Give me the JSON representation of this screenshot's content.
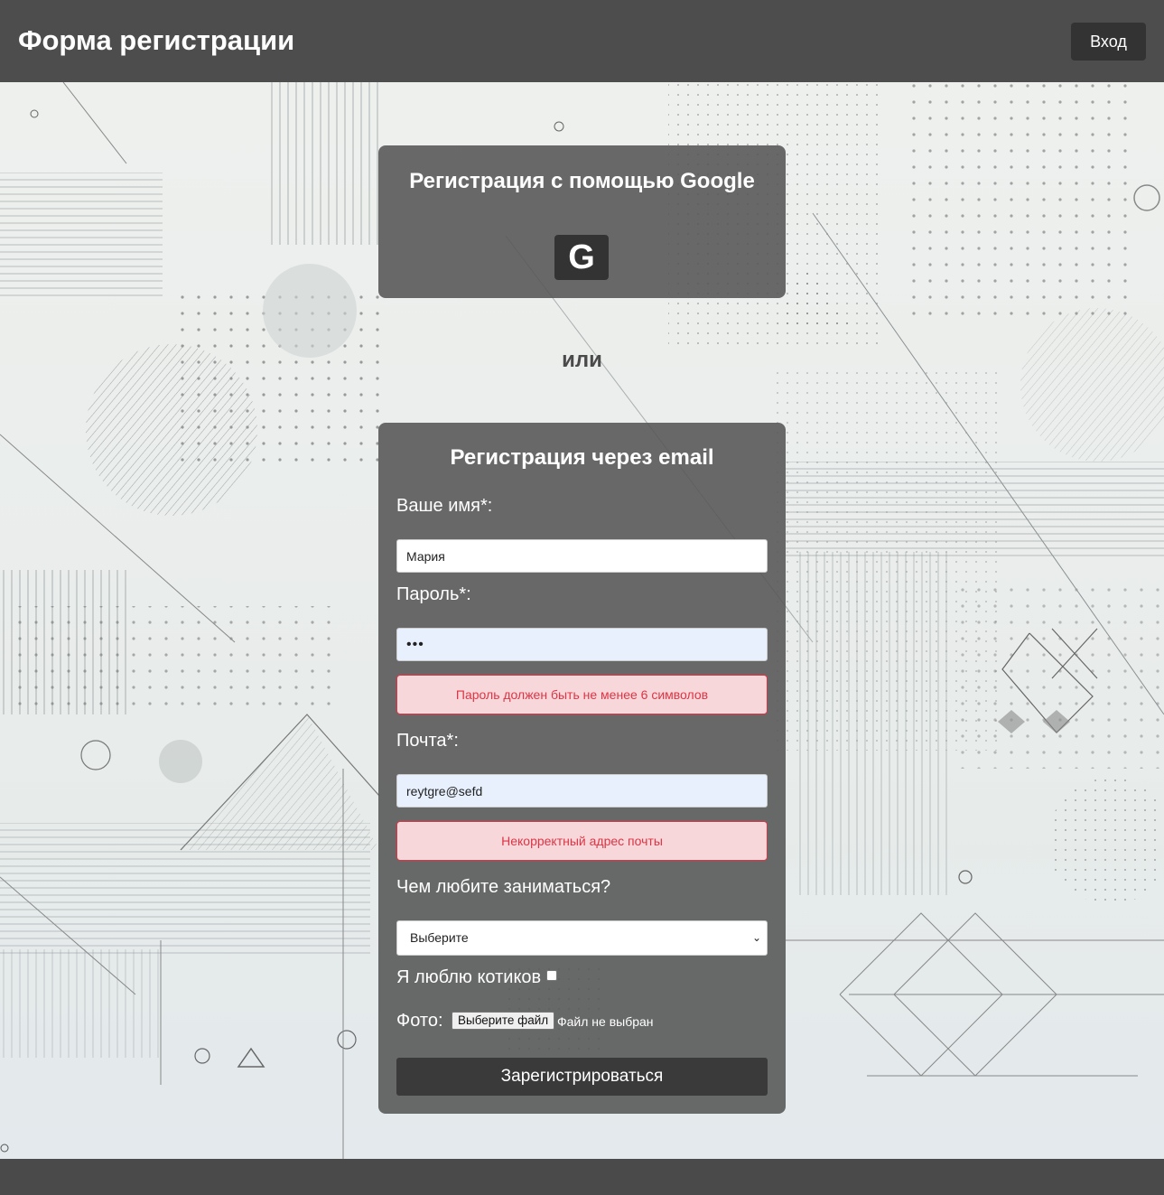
{
  "header": {
    "title": "Форма регистрации",
    "login_label": "Вход"
  },
  "google_section": {
    "title": "Регистрация с помощью Google",
    "button_glyph": "G",
    "icon": "google-icon"
  },
  "divider_text": "или",
  "email_section": {
    "title": "Регистрация через email",
    "name": {
      "label": "Ваше имя*:",
      "value": "Мария"
    },
    "password": {
      "label": "Пароль*:",
      "value": "•••",
      "error": "Пароль должен быть не менее 6 символов"
    },
    "email": {
      "label": "Почта*:",
      "value": "reytgre@sefd",
      "error": "Некорректный адрес почты"
    },
    "hobby": {
      "label": "Чем любите заниматься?",
      "selected": "Выберите"
    },
    "cats_checkbox": {
      "label": "Я люблю котиков",
      "checked": false
    },
    "photo": {
      "label": "Фото:",
      "button_label": "Выберите файл",
      "status": "Файл не выбран"
    },
    "submit_label": "Зарегистрироваться"
  },
  "colors": {
    "header_bg": "#4d4d4d",
    "card_bg": "#555555",
    "error_bg": "#f8d7da",
    "error_text": "#dc3545",
    "button_dark": "#333333"
  }
}
